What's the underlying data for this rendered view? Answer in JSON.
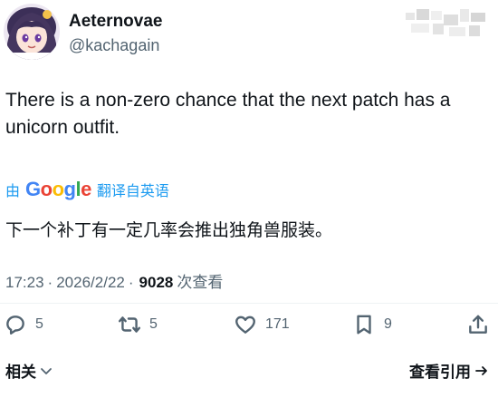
{
  "author": {
    "display_name": "Aeternovae",
    "handle": "@kachagain"
  },
  "tweet": {
    "text": "There is a non-zero chance that the next patch has a unicorn outfit.",
    "translation_prefix": "由",
    "translation_provider": "Google",
    "translation_suffix": "翻译自英语",
    "translated_text": "下一个补丁有一定几率会推出独角兽服装。"
  },
  "meta": {
    "time": "17:23",
    "separator": "·",
    "date": "2026/2/22",
    "views_count": "9028",
    "views_label": "次查看"
  },
  "actions": {
    "replies": "5",
    "retweets": "5",
    "likes": "171",
    "bookmarks": "9"
  },
  "footer": {
    "related_label": "相关",
    "quotes_label": "查看引用"
  },
  "colors": {
    "accent": "#1d9bf0",
    "text": "#0f1419",
    "secondary": "#536471"
  }
}
